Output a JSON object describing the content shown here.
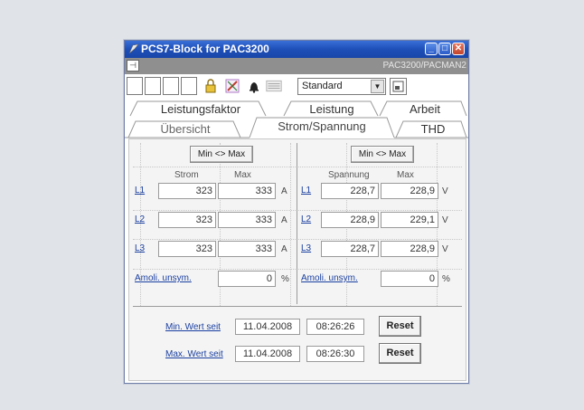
{
  "window": {
    "title": "PCS7-Block for PAC3200"
  },
  "graybar": {
    "device": "PAC3200/PACMAN2"
  },
  "toolbar": {
    "view_selected": "Standard"
  },
  "tabs": {
    "row1": [
      "Leistungsfaktor",
      "Leistung",
      "Arbeit"
    ],
    "row2": [
      "Übersicht",
      "Strom/Spannung",
      "THD"
    ],
    "active": "Strom/Spannung"
  },
  "current": {
    "minmax_button": "Min <> Max",
    "header_value": "Strom",
    "header_max": "Max",
    "unit": "A",
    "rows": [
      {
        "label": "L1",
        "value": "323",
        "max": "333"
      },
      {
        "label": "L2",
        "value": "323",
        "max": "333"
      },
      {
        "label": "L3",
        "value": "323",
        "max": "333"
      }
    ],
    "asym_label": "Amoli. unsym.",
    "asym_value": "0",
    "asym_unit": "%"
  },
  "voltage": {
    "minmax_button": "Min <> Max",
    "header_value": "Spannung",
    "header_max": "Max",
    "unit": "V",
    "rows": [
      {
        "label": "L1",
        "value": "228,7",
        "max": "228,9"
      },
      {
        "label": "L2",
        "value": "228,9",
        "max": "229,1"
      },
      {
        "label": "L3",
        "value": "228,7",
        "max": "228,9"
      }
    ],
    "asym_label": "Amoli. unsym.",
    "asym_value": "0",
    "asym_unit": "%"
  },
  "reset_rows": [
    {
      "label": "Min. Wert seit",
      "date": "11.04.2008",
      "time": "08:26:26",
      "button": "Reset"
    },
    {
      "label": "Max. Wert seit",
      "date": "11.04.2008",
      "time": "08:26:30",
      "button": "Reset"
    }
  ],
  "colors": {
    "titlebar": "#2557c0",
    "link": "#1a3fa0",
    "close": "#c2452c"
  }
}
